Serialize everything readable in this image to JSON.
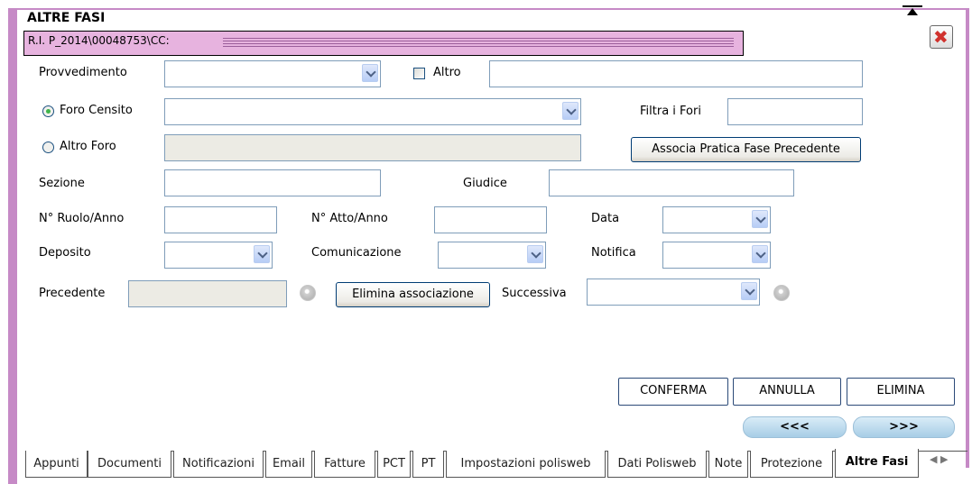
{
  "title": "ALTRE FASI",
  "riferimento": "R.I. P_2014\\00048753\\CC:",
  "fields": {
    "provvedimento": "Provvedimento",
    "altro": "Altro",
    "foro_censito": "Foro Censito",
    "filtra_fori": "Filtra i Fori",
    "altro_foro": "Altro Foro",
    "associa_btn": "Associa Pratica Fase Precedente",
    "sezione": "Sezione",
    "giudice": "Giudice",
    "ruolo": "N° Ruolo/Anno",
    "atto": "N° Atto/Anno",
    "data": "Data",
    "deposito": "Deposito",
    "comunicazione": "Comunicazione",
    "notifica": "Notifica",
    "precedente": "Precedente",
    "elimina_assoc_btn": "Elimina associazione",
    "successiva": "Successiva"
  },
  "actions": {
    "conferma": "CONFERMA",
    "annulla": "ANNULLA",
    "elimina": "ELIMINA",
    "prev": "<<<",
    "next": ">>>"
  },
  "tabs": [
    "Appunti",
    "Documenti",
    "Notificazioni",
    "Email",
    "Fatture",
    "PCT",
    "PT",
    "Impostazioni polisweb",
    "Dati Polisweb",
    "Note",
    "Protezione",
    "Altre Fasi"
  ],
  "tab_scroll": "◀ ▶",
  "colors": {
    "frame": "#c68ac6",
    "riferimento_bg": "#e7b3df"
  }
}
